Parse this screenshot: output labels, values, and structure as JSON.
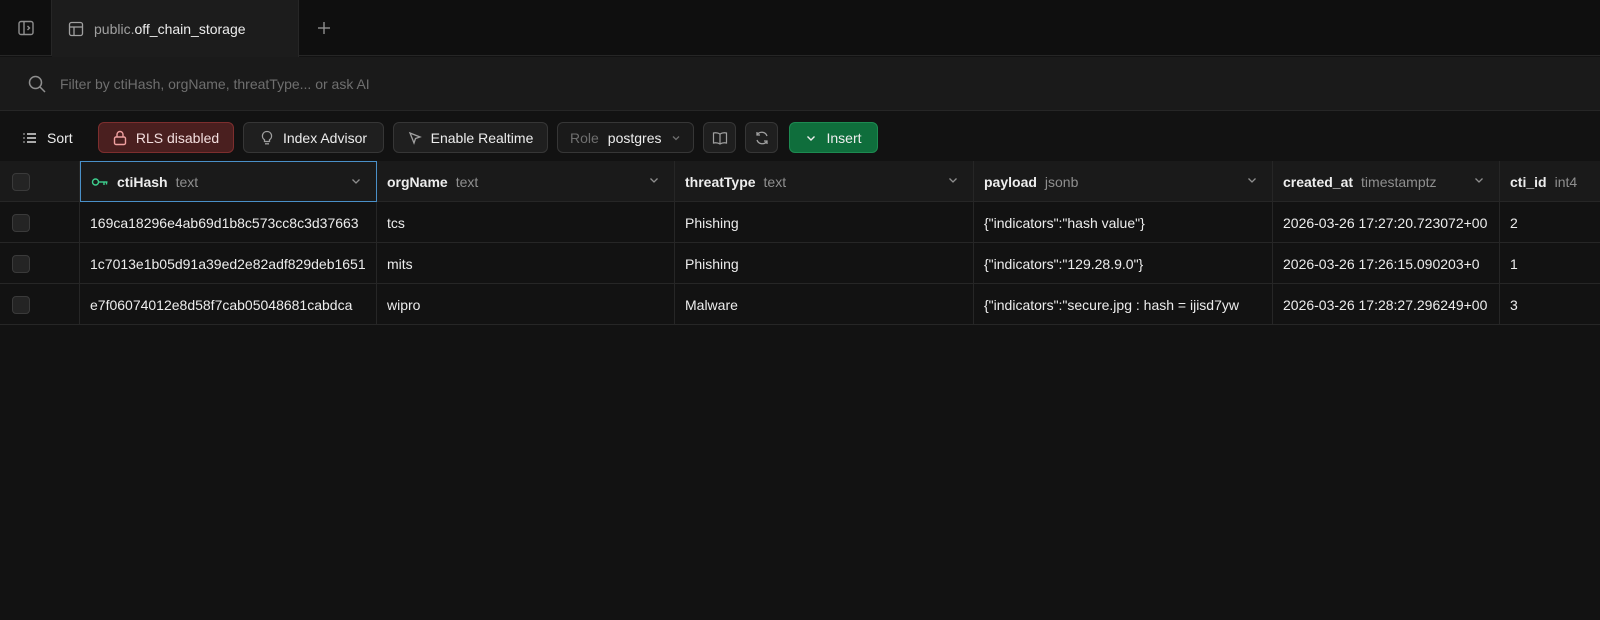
{
  "tab": {
    "schema": "public.",
    "table": "off_chain_storage",
    "new_tab_glyph": "+"
  },
  "filter": {
    "placeholder": "Filter by ctiHash, orgName, threatType... or ask AI"
  },
  "toolbar": {
    "sort_label": "Sort",
    "rls_label": "RLS disabled",
    "index_advisor_label": "Index Advisor",
    "realtime_label": "Enable Realtime",
    "role_label": "Role",
    "role_value": "postgres",
    "insert_label": "Insert"
  },
  "columns": [
    {
      "name": "ctiHash",
      "type": "text",
      "primary_key": true
    },
    {
      "name": "orgName",
      "type": "text"
    },
    {
      "name": "threatType",
      "type": "text"
    },
    {
      "name": "payload",
      "type": "jsonb"
    },
    {
      "name": "created_at",
      "type": "timestamptz"
    },
    {
      "name": "cti_id",
      "type": "int4"
    }
  ],
  "rows": [
    [
      "169ca18296e4ab69d1b8c573cc8c3d37663",
      "tcs",
      "Phishing",
      "{\"indicators\":\"hash value\"}",
      "2026-03-26 17:27:20.723072+00",
      "2"
    ],
    [
      "1c7013e1b05d91a39ed2e82adf829deb1651",
      "mits",
      "Phishing",
      "{\"indicators\":\"129.28.9.0\"}",
      "2026-03-26 17:26:15.090203+0",
      "1"
    ],
    [
      "e7f06074012e8d58f7cab05048681cabdca",
      "wipro",
      "Malware",
      "{\"indicators\":\"secure.jpg : hash = ijisd7yw",
      "2026-03-26 17:28:27.296249+00",
      "3"
    ]
  ],
  "colors": {
    "accent_green": "#3ecf8e",
    "insert_bg": "#0f6e3c",
    "rls_bg": "#4a1f1f",
    "selected_border": "#4a90c8"
  },
  "icons": [
    "sidebar-toggle-icon",
    "table-icon",
    "plus-icon",
    "search-icon",
    "sort-icon",
    "lock-icon",
    "lightbulb-icon",
    "realtime-icon",
    "chevron-down-icon",
    "book-icon",
    "refresh-icon",
    "key-icon"
  ]
}
